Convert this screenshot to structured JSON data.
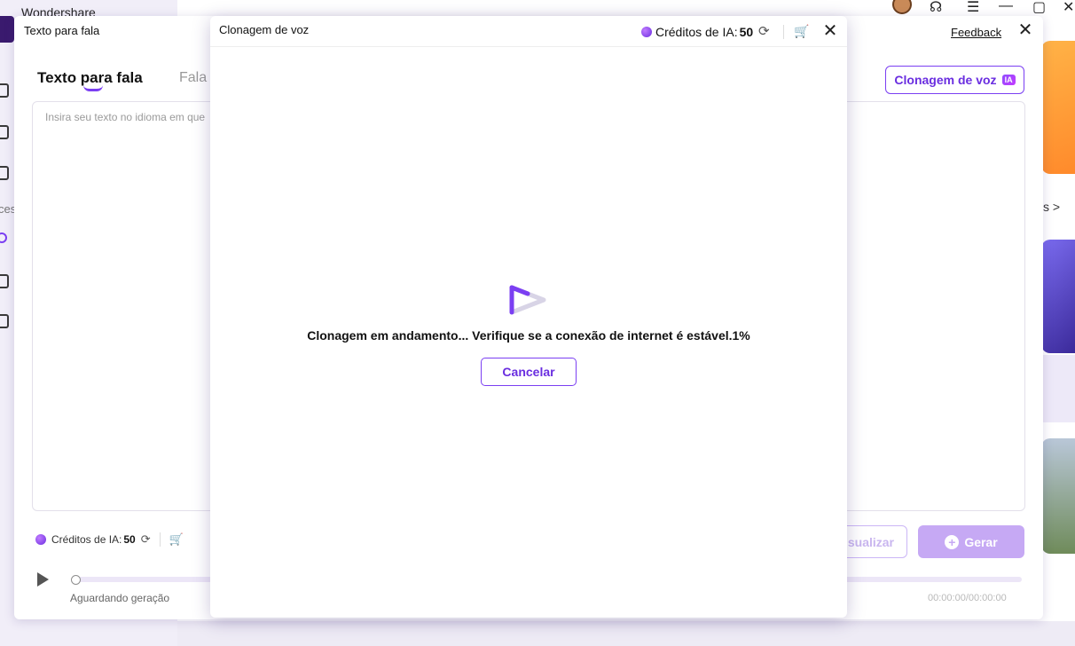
{
  "background": {
    "app_title": "Wondershare",
    "nav_section_fragment": "ces",
    "right_link_fragment": "s >"
  },
  "tts_window": {
    "title": "Texto para fala",
    "feedback_link": "Feedback",
    "tabs": [
      {
        "label": "Texto para fala",
        "active": true
      },
      {
        "label": "Fala"
      }
    ],
    "clone_button": {
      "label": "Clonagem de voz",
      "badge": "IA"
    },
    "textarea_placeholder": "Insira seu texto no idioma em que",
    "credits": {
      "label": "Créditos de IA:",
      "value": "50"
    },
    "preview_button_fragment": "sualizar",
    "generate_button": "Gerar",
    "player": {
      "status": "Aguardando geração",
      "time": "00:00:00/00:00:00",
      "progress": 0
    }
  },
  "modal": {
    "title": "Clonagem de voz",
    "credits": {
      "label": "Créditos de IA:",
      "value": "50"
    },
    "message": "Clonagem em andamento... Verifique se a conexão de internet é estável.1%",
    "progress_percent": 1,
    "cancel_button": "Cancelar"
  },
  "colors": {
    "accent": "#7b3ff2",
    "accent_dark": "#6a2ee0",
    "accent_light": "#c6a9f4"
  },
  "icons": {
    "refresh": "refresh-icon",
    "cart": "cart-icon",
    "close": "close-icon",
    "credit": "credit-coin-icon",
    "play": "play-icon"
  }
}
